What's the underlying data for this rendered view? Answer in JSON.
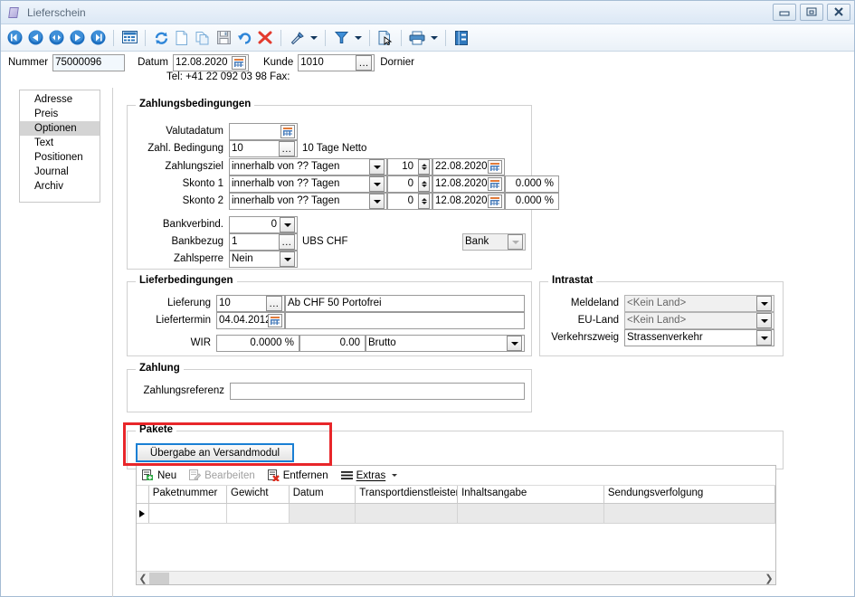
{
  "window": {
    "title": "Lieferschein",
    "icon": "document-icon",
    "controls": {
      "minimize": "Minimieren",
      "restore": "Wiederherstellen",
      "close": "Schliessen"
    }
  },
  "toolbar": {
    "buttons": [
      {
        "name": "first-record",
        "label": "Erster Datensatz"
      },
      {
        "name": "previous-record",
        "label": "Vorheriger Datensatz"
      },
      {
        "name": "toggle-record",
        "label": "Wechseln"
      },
      {
        "name": "next-record",
        "label": "Nächster Datensatz"
      },
      {
        "name": "last-record",
        "label": "Letzter Datensatz"
      },
      {
        "name": "table-view",
        "label": "Tabellenansicht"
      },
      {
        "name": "refresh",
        "label": "Aktualisieren"
      },
      {
        "name": "new-document",
        "label": "Neu"
      },
      {
        "name": "copy",
        "label": "Kopieren"
      },
      {
        "name": "save",
        "label": "Speichern"
      },
      {
        "name": "undo",
        "label": "Rückgängig"
      },
      {
        "name": "delete",
        "label": "Löschen"
      },
      {
        "name": "pin",
        "label": "Anheften"
      },
      {
        "name": "filter",
        "label": "Filter"
      },
      {
        "name": "preview",
        "label": "Vorschau"
      },
      {
        "name": "print",
        "label": "Drucken"
      },
      {
        "name": "book",
        "label": "Journal"
      }
    ]
  },
  "header": {
    "nummer_label": "Nummer",
    "nummer_value": "75000096",
    "datum_label": "Datum",
    "datum_value": "12.08.2020",
    "kunde_label": "Kunde",
    "kunde_value": "1010",
    "kunde_name": "Dornier",
    "contact": "Tel: +41 22 092 03 98    Fax:"
  },
  "nav": {
    "items": [
      {
        "label": "Adresse",
        "selected": false
      },
      {
        "label": "Preis",
        "selected": false
      },
      {
        "label": "Optionen",
        "selected": true
      },
      {
        "label": "Text",
        "selected": false
      },
      {
        "label": "Positionen",
        "selected": false
      },
      {
        "label": "Journal",
        "selected": false
      },
      {
        "label": "Archiv",
        "selected": false
      }
    ]
  },
  "zahlungsbedingungen": {
    "title": "Zahlungsbedingungen",
    "valutadatum": {
      "label": "Valutadatum",
      "value": ""
    },
    "zahl_bedingung": {
      "label": "Zahl. Bedingung",
      "value": "10",
      "description": "10 Tage Netto"
    },
    "zahlungsziel": {
      "label": "Zahlungsziel",
      "mode": "innerhalb von ?? Tagen",
      "days": "10",
      "date": "22.08.2020"
    },
    "skonto1": {
      "label": "Skonto 1",
      "mode": "innerhalb von ?? Tagen",
      "days": "0",
      "date": "12.08.2020",
      "percent": "0.000 %"
    },
    "skonto2": {
      "label": "Skonto 2",
      "mode": "innerhalb von ?? Tagen",
      "days": "0",
      "date": "12.08.2020",
      "percent": "0.000 %"
    },
    "bankverbind": {
      "label": "Bankverbind.",
      "value": "0"
    },
    "bankbezug": {
      "label": "Bankbezug",
      "value": "1",
      "description": "UBS CHF",
      "type": "Bank"
    },
    "zahlsperre": {
      "label": "Zahlsperre",
      "value": "Nein"
    }
  },
  "lieferbedingungen": {
    "title": "Lieferbedingungen",
    "lieferung": {
      "label": "Lieferung",
      "value": "10",
      "description": "Ab CHF 50 Portofrei"
    },
    "liefertermin": {
      "label": "Liefertermin",
      "value": "04.04.2012"
    },
    "wir": {
      "label": "WIR",
      "percent": "0.0000 %",
      "amount": "0.00",
      "basis": "Brutto"
    }
  },
  "intrastat": {
    "title": "Intrastat",
    "meldeland": {
      "label": "Meldeland",
      "value": "<Kein Land>"
    },
    "eu_land": {
      "label": "EU-Land",
      "value": "<Kein Land>"
    },
    "verkehrszweig": {
      "label": "Verkehrszweig",
      "value": "Strassenverkehr"
    }
  },
  "zahlung": {
    "title": "Zahlung",
    "zahlungsreferenz": {
      "label": "Zahlungsreferenz",
      "value": ""
    }
  },
  "pakete": {
    "title": "Pakete",
    "transfer_button": "Übergabe an Versandmodul",
    "grid_toolbar": [
      {
        "label": "Neu",
        "icon": "new-row-icon",
        "disabled": false
      },
      {
        "label": "Bearbeiten",
        "icon": "edit-row-icon",
        "disabled": true
      },
      {
        "label": "Entfernen",
        "icon": "remove-row-icon",
        "disabled": false
      },
      {
        "label": "Extras",
        "icon": "menu-icon",
        "disabled": false
      }
    ],
    "columns": [
      "Paketnummer",
      "Gewicht",
      "Datum",
      "Transportdienstleister",
      "Inhaltsangabe",
      "Sendungsverfolgung"
    ],
    "rows": [
      {
        "cells": [
          "",
          "",
          "",
          "",
          "",
          ""
        ],
        "current": true
      }
    ]
  },
  "colors": {
    "highlight_red": "#e8262a",
    "focus_blue": "#1a7fd4",
    "accent_blue": "#1d6fc0",
    "selection_grey": "#d4d4d4"
  }
}
